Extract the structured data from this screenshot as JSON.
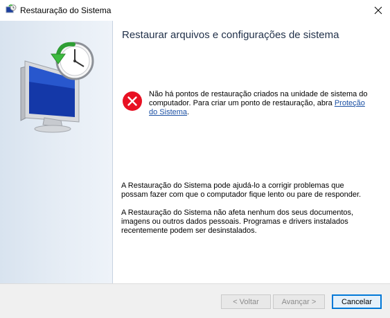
{
  "window": {
    "title": "Restauração do Sistema",
    "app_icon": "system-restore-icon",
    "close_icon": "close-icon"
  },
  "sidebar": {
    "hero_icon": "system-restore-monitor-clock-icon"
  },
  "main": {
    "heading": "Restaurar arquivos e configurações de sistema",
    "error": {
      "icon": "error-icon",
      "text_before_link": "Não há pontos de restauração criados na unidade de sistema do computador. Para criar um ponto de restauração, abra ",
      "link_text": "Proteção do Sistema",
      "text_after_link": "."
    },
    "info_paragraph_1": "A Restauração do Sistema pode ajudá-lo a corrigir problemas que possam fazer com que o computador fique lento ou pare de responder.",
    "info_paragraph_2": "A Restauração do Sistema não afeta nenhum dos seus documentos, imagens ou outros dados pessoais. Programas e drivers instalados recentemente podem ser desinstalados."
  },
  "footer": {
    "back_label": "< Voltar",
    "next_label": "Avançar >",
    "cancel_label": "Cancelar"
  },
  "colors": {
    "link": "#1a4fa3",
    "error_red": "#e81123",
    "heading": "#1f2f48",
    "sidebar_bg": "#dfe8f2"
  }
}
